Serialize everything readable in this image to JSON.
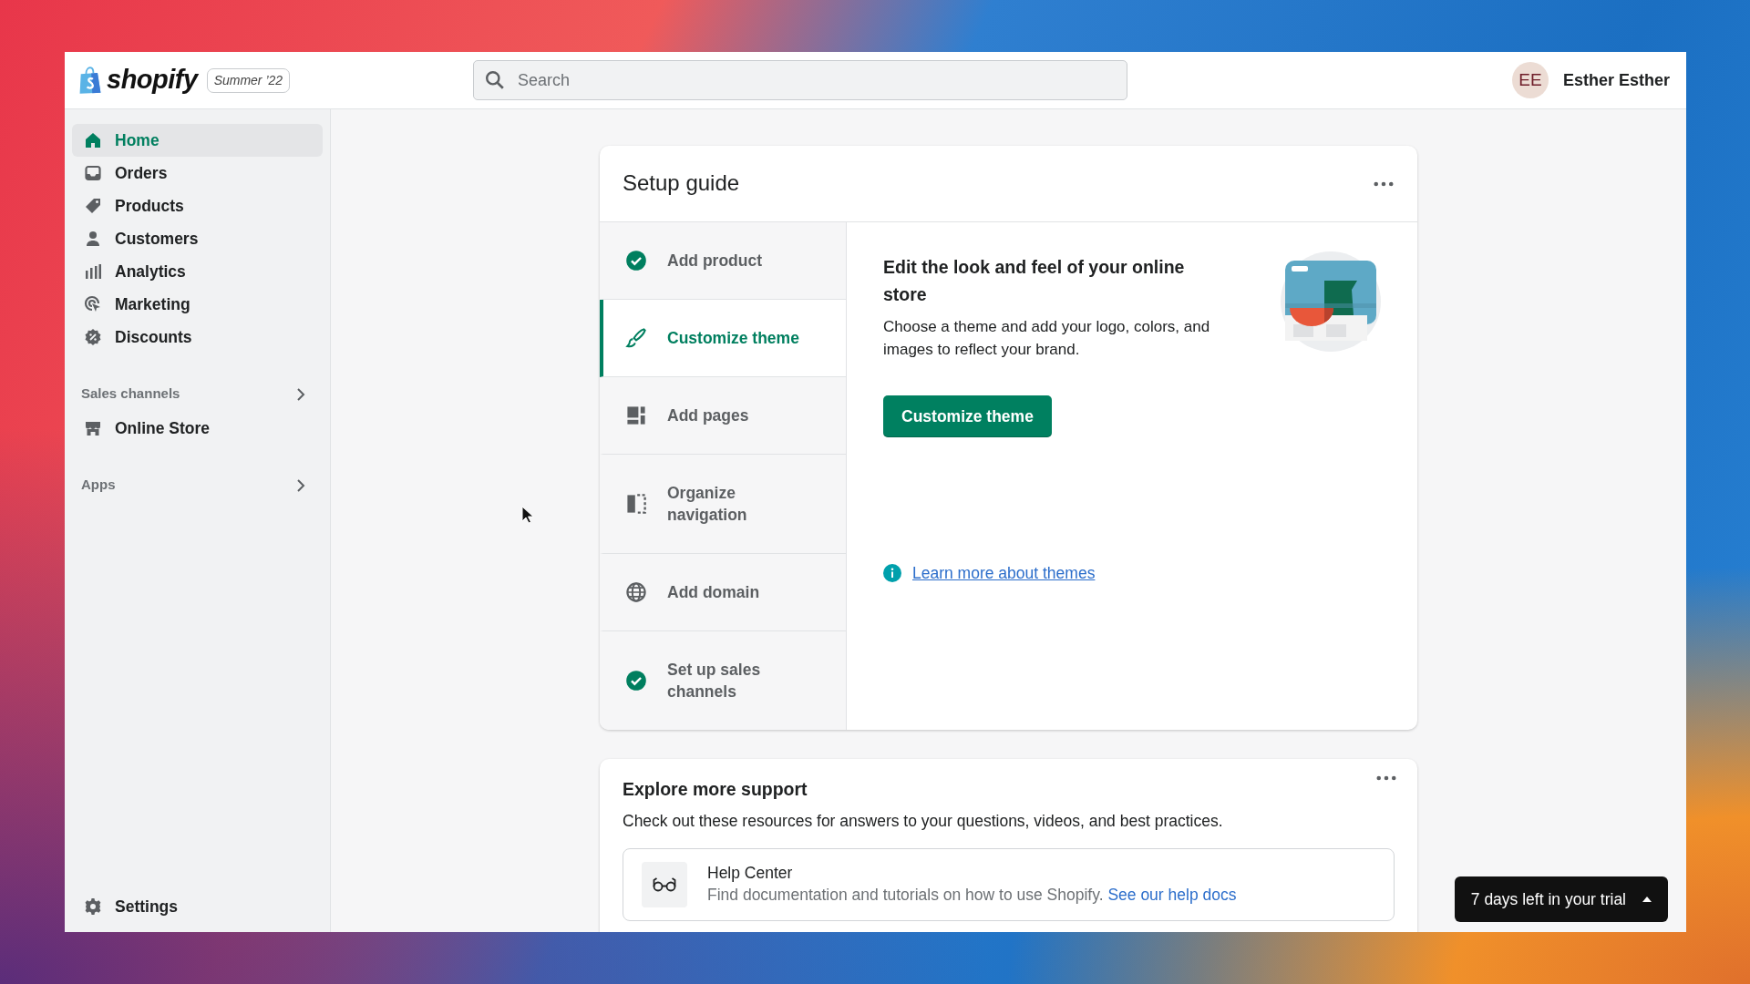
{
  "topbar": {
    "logo": "shopify",
    "edition_badge": "Summer ’22",
    "search": {
      "placeholder": "Search"
    },
    "user": {
      "initials": "EE",
      "name": "Esther Esther"
    }
  },
  "sidebar": {
    "items": [
      {
        "label": "Home",
        "selected": true
      },
      {
        "label": "Orders",
        "selected": false
      },
      {
        "label": "Products",
        "selected": false
      },
      {
        "label": "Customers",
        "selected": false
      },
      {
        "label": "Analytics",
        "selected": false
      },
      {
        "label": "Marketing",
        "selected": false
      },
      {
        "label": "Discounts",
        "selected": false
      }
    ],
    "sections": [
      {
        "title": "Sales channels",
        "items": [
          {
            "label": "Online Store",
            "selected": false
          }
        ]
      },
      {
        "title": "Apps"
      }
    ],
    "settings": {
      "label": "Settings"
    }
  },
  "setup_guide": {
    "title": "Setup guide",
    "steps": [
      {
        "label": "Add product",
        "done": true,
        "selected": false
      },
      {
        "label": "Customize theme",
        "done": false,
        "selected": true
      },
      {
        "label": "Add pages",
        "done": false,
        "selected": false
      },
      {
        "label": "Organize navigation",
        "done": false,
        "selected": false
      },
      {
        "label": "Add domain",
        "done": false,
        "selected": false
      },
      {
        "label": "Set up sales channels",
        "done": true,
        "selected": false
      }
    ],
    "detail": {
      "heading": "Edit the look and feel of your online store",
      "body": "Choose a theme and add your logo, colors, and images to reflect your brand.",
      "button": "Customize theme",
      "link": "Learn more about themes"
    }
  },
  "support": {
    "title": "Explore more support",
    "intro": "Check out these resources for answers to your questions, videos, and best practices.",
    "resources": [
      {
        "title": "Help Center",
        "body": "Find documentation and tutorials on how to use Shopify.",
        "link": "See our help docs"
      }
    ]
  },
  "trial": {
    "label": "7 days left in your trial"
  }
}
